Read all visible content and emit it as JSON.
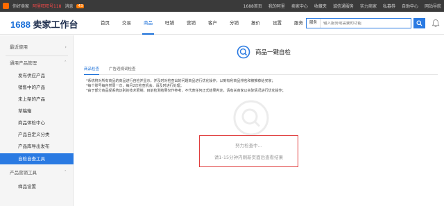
{
  "topbar": {
    "left_items": [
      "你好卖家",
      "阿里旺旺号118",
      "消息",
      "43"
    ],
    "right_items": [
      "1688首页",
      "我的阿里",
      "卖家中心",
      "收藏夹",
      "诚信通服务",
      "实力商家",
      "私募券",
      "自助中心",
      "网站导航"
    ]
  },
  "header": {
    "brand_number": "1688",
    "brand_text": "卖家工作台",
    "nav": [
      "首页",
      "交易",
      "商品",
      "旺铺",
      "营销",
      "客户",
      "分销",
      "报价",
      "设置",
      "服务"
    ],
    "active_nav_index": 2,
    "search_scope": "服务",
    "search_placeholder": "输入服务或需要的功能"
  },
  "sidebar": {
    "section_recent": "最近使用",
    "section_product_mgmt": "通用产品管理",
    "items": [
      "发布供应产品",
      "销售中的产品",
      "未上架的产品",
      "草稿箱",
      "商品体检中心",
      "产品自定义分类",
      "产品库导出发布",
      "自检自查工具"
    ],
    "active_item_index": 7,
    "section_marketing": "产品营销工具",
    "sub_marketing": "样品设置"
  },
  "main": {
    "feature_title": "商品一键自检",
    "tabs": [
      "商品检查",
      "广告违规词检查"
    ],
    "active_tab_index": 0,
    "notes": [
      "*系统将对所有商品的商品进行自检并显示，并及时对检查出的问题商品进行优化操作，以到有利商品排名和被推荐给买家；",
      "*每个账号每自然周一次，每月2次检查机会，请及时进行处理；",
      "*由于部分商品受系统识别的技术限制，目前检测结果仅作参考，不代表任何正式结果判定，请有关商家以实际情况进行优化操作；"
    ],
    "status_line1": "努力检查中...",
    "status_line2": "请1-15分钟内刷新页面后查看结果"
  },
  "colors": {
    "accent": "#2a7ae2",
    "topbar_bg": "#3a3a3a",
    "alert_border": "#e03b3b"
  }
}
